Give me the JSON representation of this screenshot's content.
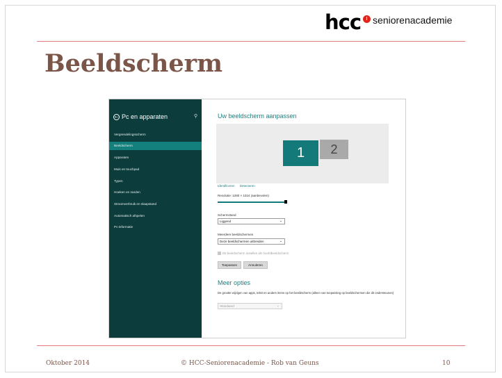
{
  "slide": {
    "title": "Beeldscherm",
    "logo_main": "hcc",
    "logo_sub": "seniorenacademie",
    "footer_left": "Oktober 2014",
    "footer_center": "© HCC-Seniorenacademie - Rob van Geuns",
    "footer_right": "10"
  },
  "colors": {
    "sidebar": "#0d3c3c",
    "accent": "#137a79",
    "title": "#7a5548",
    "rule": "#e07a7a"
  },
  "sidebar": {
    "title": "Pc en apparaten",
    "search_icon": "search-icon",
    "items": [
      {
        "label": "Vergrendelingsscherm"
      },
      {
        "label": "Beeldscherm",
        "active": true
      },
      {
        "label": "Apparaten"
      },
      {
        "label": "Muis en touchpad"
      },
      {
        "label": "Typen"
      },
      {
        "label": "Hoeken en randen"
      },
      {
        "label": "Stroomverbruik en slaapstand"
      },
      {
        "label": "Automatisch afspelen"
      },
      {
        "label": "Pc-informatie"
      }
    ]
  },
  "main": {
    "title": "Uw beeldscherm aanpassen",
    "monitor1": "1",
    "monitor2": "2",
    "link_identify": "Identificeren",
    "link_detect": "Detecteren",
    "resolution_label": "Resolutie: 1280 × 1024 (aanbevolen)",
    "orientation_label": "Schermstand",
    "orientation_value": "Liggend",
    "multi_label": "Meerdere beeldschermen",
    "multi_value": "Deze beeldschermen uitbreiden",
    "checkbox_label": "Dit beeldscherm instellen als hoofdbeeldscherm",
    "apply_button": "Toepassen",
    "cancel_button": "Annuleren",
    "more_title": "Meer opties",
    "more_desc": "De grootte wijzigen van apps, tekst en andere items op het beeldscherm (alleen van toepassing op beeldschermen die dit ondersteunen)",
    "size_value": "Standaard"
  }
}
